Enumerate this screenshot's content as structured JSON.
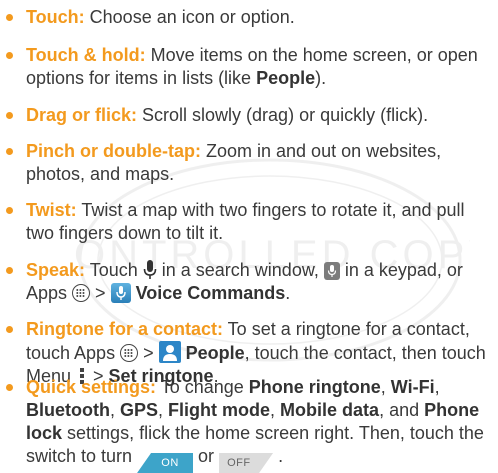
{
  "colors": {
    "accent": "#f39a1e",
    "text": "#3a3a3a",
    "toggle_on": "#3da4c9",
    "toggle_off": "#dcdcdc"
  },
  "watermark": {
    "text": "CONTROLLED COPY"
  },
  "items": [
    {
      "term": "Touch:",
      "text": " Choose an icon or option."
    },
    {
      "term": "Touch & hold:",
      "text_a": " Move items on the home screen, or open options for items in lists (like ",
      "bold_a": "People",
      "text_b": ")."
    },
    {
      "term": "Drag or flick:",
      "text": " Scroll slowly (drag) or quickly (flick)."
    },
    {
      "term": "Pinch or double-tap:",
      "text": " Zoom in and out on websites, photos, and maps."
    },
    {
      "term": "Twist:",
      "text": " Twist a map with two fingers to rotate it, and pull two fingers down to tilt it."
    },
    {
      "term": "Speak:",
      "text_a": " Touch ",
      "text_b": " in a search window, ",
      "text_c": " in a keypad, or Apps ",
      "text_d": " > ",
      "bold_a": "Voice Commands",
      "text_e": "."
    },
    {
      "term": "Ringtone for a contact:",
      "text_a": " To set a ringtone for a contact, touch Apps ",
      "text_b": " > ",
      "bold_a": "People",
      "text_c": ", touch the contact, then touch Menu ",
      "text_d": " > ",
      "bold_b": "Set ringtone",
      "text_e": "."
    },
    {
      "term": "Quick settings:",
      "text_a": " To change ",
      "bold_a": "Phone ringtone",
      "text_b": ", ",
      "bold_b": "Wi-Fi",
      "text_c": ", ",
      "bold_c": "Bluetooth",
      "text_d": ", ",
      "bold_d": "GPS",
      "text_e": ", ",
      "bold_e": "Flight mode",
      "text_f": ", ",
      "bold_f": "Mobile data",
      "text_g": ", and ",
      "bold_g": "Phone lock",
      "text_h": " settings, flick the home screen right. Then, touch the switch to turn ",
      "toggle_on": "ON",
      "text_i": " or ",
      "toggle_off": "OFF",
      "text_j": " ."
    }
  ]
}
